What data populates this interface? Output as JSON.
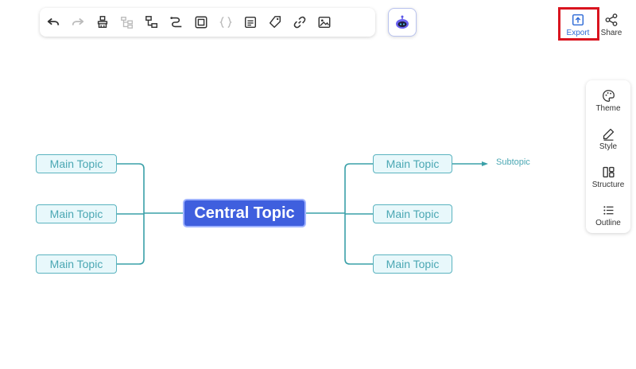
{
  "toolbar": {
    "items": [
      {
        "icon": "undo-icon"
      },
      {
        "icon": "redo-icon"
      },
      {
        "icon": "format-painter-icon"
      },
      {
        "icon": "add-topic-icon"
      },
      {
        "icon": "add-subtopic-icon"
      },
      {
        "icon": "relationship-icon"
      },
      {
        "icon": "boundary-icon"
      },
      {
        "icon": "summary-icon"
      },
      {
        "icon": "note-icon"
      },
      {
        "icon": "label-icon"
      },
      {
        "icon": "link-icon"
      },
      {
        "icon": "image-icon"
      }
    ],
    "ai_icon": "ai-robot-icon"
  },
  "header": {
    "export_label": "Export",
    "share_label": "Share",
    "highlight_color": "#d9141f"
  },
  "sidepanel": {
    "items": [
      {
        "label": "Theme",
        "icon": "palette-icon"
      },
      {
        "label": "Style",
        "icon": "pen-icon"
      },
      {
        "label": "Structure",
        "icon": "structure-icon"
      },
      {
        "label": "Outline",
        "icon": "outline-icon"
      }
    ]
  },
  "mindmap": {
    "central": "Central Topic",
    "left_topics": [
      "Main Topic",
      "Main Topic",
      "Main Topic"
    ],
    "right_topics": [
      "Main Topic",
      "Main Topic",
      "Main Topic"
    ],
    "subtopic": "Subtopic",
    "colors": {
      "central_fill": "#3f5fde",
      "topic_border": "#5ab3bf",
      "topic_fill": "#e8f8fb",
      "connector": "#3aa0a8"
    }
  }
}
